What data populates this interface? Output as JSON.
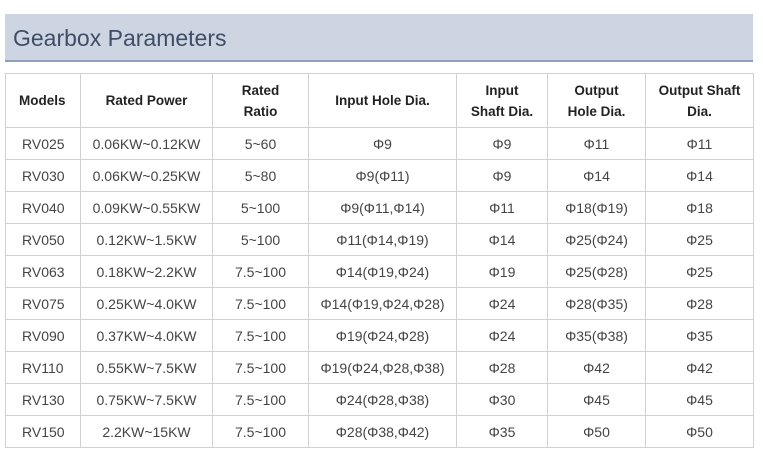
{
  "title": "Gearbox Parameters",
  "columns": [
    [
      "Models"
    ],
    [
      "Rated Power"
    ],
    [
      "Rated",
      "Ratio"
    ],
    [
      "Input Hole Dia."
    ],
    [
      "Input",
      "Shaft Dia."
    ],
    [
      "Output",
      "Hole Dia."
    ],
    [
      "Output Shaft",
      "Dia."
    ]
  ],
  "rows": [
    [
      "RV025",
      "0.06KW~0.12KW",
      "5~60",
      "Φ9",
      "Φ9",
      "Φ11",
      "Φ11"
    ],
    [
      "RV030",
      "0.06KW~0.25KW",
      "5~80",
      "Φ9(Φ11)",
      "Φ9",
      "Φ14",
      "Φ14"
    ],
    [
      "RV040",
      "0.09KW~0.55KW",
      "5~100",
      "Φ9(Φ11,Φ14)",
      "Φ11",
      "Φ18(Φ19)",
      "Φ18"
    ],
    [
      "RV050",
      "0.12KW~1.5KW",
      "5~100",
      "Φ11(Φ14,Φ19)",
      "Φ14",
      "Φ25(Φ24)",
      "Φ25"
    ],
    [
      "RV063",
      "0.18KW~2.2KW",
      "7.5~100",
      "Φ14(Φ19,Φ24)",
      "Φ19",
      "Φ25(Φ28)",
      "Φ25"
    ],
    [
      "RV075",
      "0.25KW~4.0KW",
      "7.5~100",
      "Φ14(Φ19,Φ24,Φ28)",
      "Φ24",
      "Φ28(Φ35)",
      "Φ28"
    ],
    [
      "RV090",
      "0.37KW~4.0KW",
      "7.5~100",
      "Φ19(Φ24,Φ28)",
      "Φ24",
      "Φ35(Φ38)",
      "Φ35"
    ],
    [
      "RV110",
      "0.55KW~7.5KW",
      "7.5~100",
      "Φ19(Φ24,Φ28,Φ38)",
      "Φ28",
      "Φ42",
      "Φ42"
    ],
    [
      "RV130",
      "0.75KW~7.5KW",
      "7.5~100",
      "Φ24(Φ28,Φ38)",
      "Φ30",
      "Φ45",
      "Φ45"
    ],
    [
      "RV150",
      "2.2KW~15KW",
      "7.5~100",
      "Φ28(Φ38,Φ42)",
      "Φ35",
      "Φ50",
      "Φ50"
    ]
  ]
}
